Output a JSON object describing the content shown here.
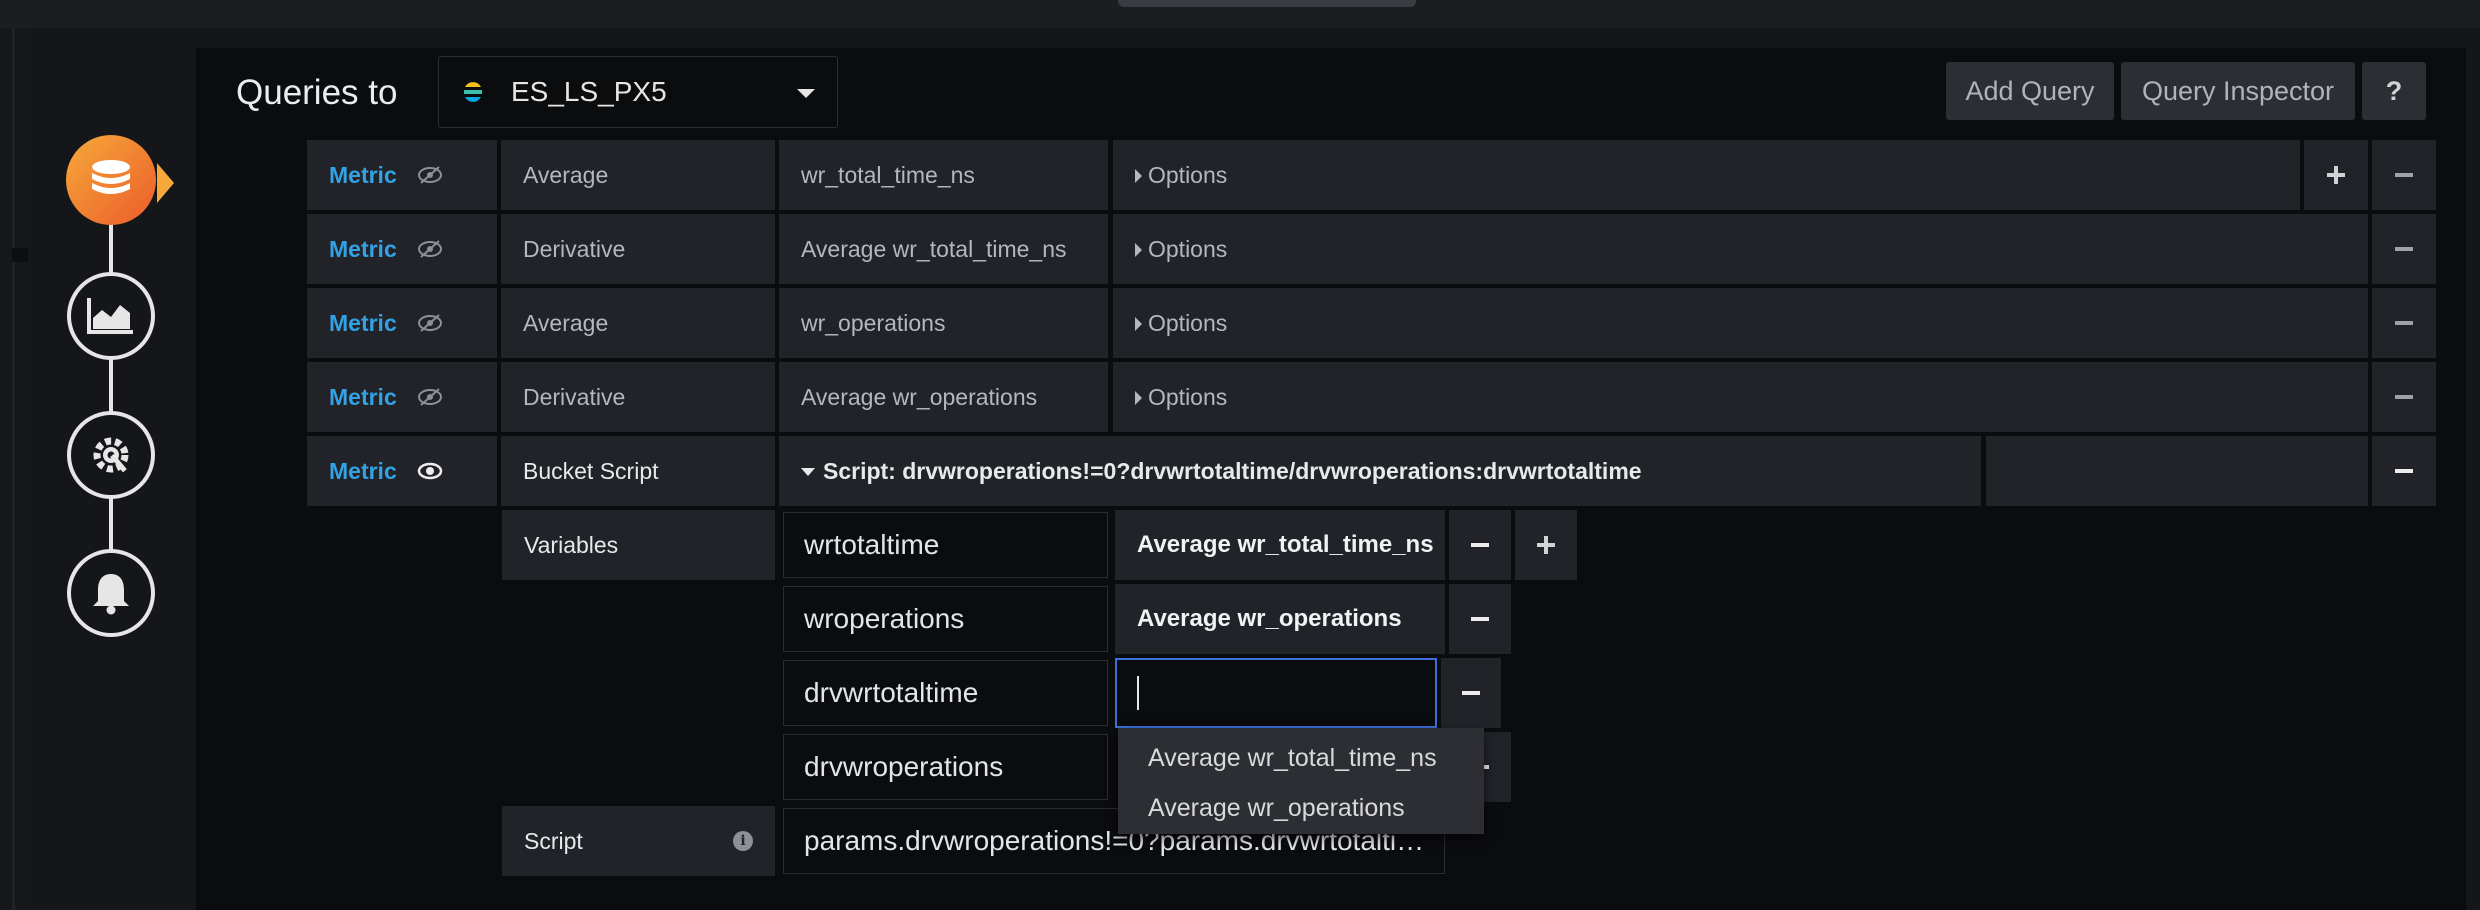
{
  "header": {
    "title": "Queries to",
    "datasource": "ES_LS_PX5",
    "buttons": {
      "add_query": "Add Query",
      "query_inspector": "Query Inspector",
      "help": "?"
    }
  },
  "steps": [
    {
      "name": "queries",
      "icon": "database-icon",
      "active": true
    },
    {
      "name": "visualization",
      "icon": "chart-icon",
      "active": false
    },
    {
      "name": "general",
      "icon": "settings-icon",
      "active": false
    },
    {
      "name": "alert",
      "icon": "bell-icon",
      "active": false
    }
  ],
  "metrics": [
    {
      "label": "Metric",
      "agg": "Average",
      "field": "wr_total_time_ns",
      "options": "Options"
    },
    {
      "label": "Metric",
      "agg": "Derivative",
      "field": "Average wr_total_time_ns",
      "options": "Options"
    },
    {
      "label": "Metric",
      "agg": "Average",
      "field": "wr_operations",
      "options": "Options"
    },
    {
      "label": "Metric",
      "agg": "Derivative",
      "field": "Average wr_operations",
      "options": "Options"
    },
    {
      "label": "Metric",
      "agg": "Bucket Script",
      "script_header": "Script: drvwroperations!=0?drvwrtotaltime/drvwroperations:drvwrtotaltime"
    }
  ],
  "bucket_script": {
    "variables_label": "Variables",
    "variables": [
      {
        "name": "wrtotaltime",
        "metric": "Average wr_total_time_ns"
      },
      {
        "name": "wroperations",
        "metric": "Average wr_operations"
      },
      {
        "name": "drvwrtotaltime",
        "metric": ""
      },
      {
        "name": "drvwroperations",
        "metric": ""
      }
    ],
    "script_label": "Script",
    "script_value": "params.drvwroperations!=0?params.drvwrtotalti…"
  },
  "dropdown": {
    "options": [
      "Average wr_total_time_ns",
      "Average wr_operations"
    ]
  },
  "colors": {
    "accent": "#33a2e5",
    "active_step": "#eb7b2a",
    "focus": "#3d71d9"
  }
}
